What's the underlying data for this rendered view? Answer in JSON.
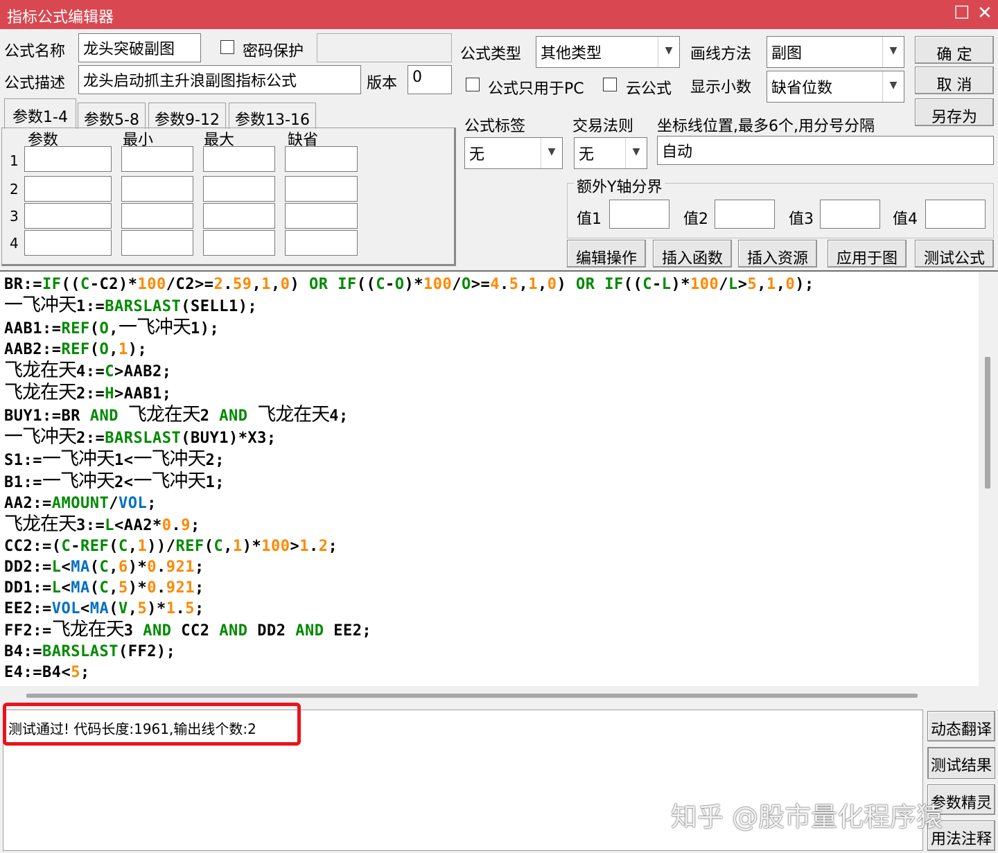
{
  "window": {
    "title": "指标公式编辑器",
    "maximize_glyph": "☐",
    "close_glyph": "✕"
  },
  "form": {
    "name_label": "公式名称",
    "name_value": "龙头突破副图",
    "password_label": "密码保护",
    "desc_label": "公式描述",
    "desc_value": "龙头启动抓主升浪副图指标公式",
    "version_label": "版本",
    "version_value": "0",
    "type_label": "公式类型",
    "type_value": "其他类型",
    "draw_label": "画线方法",
    "draw_value": "副图",
    "pc_only_label": "公式只用于PC",
    "cloud_label": "云公式",
    "decimals_label": "显示小数",
    "decimals_value": "缺省位数",
    "tag_label": "公式标签",
    "tag_value": "无",
    "trade_label": "交易法则",
    "trade_value": "无",
    "axis_label": "坐标线位置,最多6个,用分号分隔",
    "axis_value": "自动",
    "extra_y_label": "额外Y轴分界",
    "y_values": [
      "值1",
      "值2",
      "值3",
      "值4"
    ]
  },
  "buttons": {
    "ok": "确  定",
    "cancel": "取  消",
    "save_as": "另存为",
    "edit_ops": "编辑操作",
    "insert_func": "插入函数",
    "insert_res": "插入资源",
    "apply_chart": "应用于图",
    "test_formula": "测试公式",
    "dyn_translate": "动态翻译",
    "test_result": "测试结果",
    "param_wizard": "参数精灵",
    "usage_notes": "用法注释"
  },
  "params": {
    "tabs": [
      "参数1-4",
      "参数5-8",
      "参数9-12",
      "参数13-16"
    ],
    "headers": [
      "参数",
      "最小",
      "最大",
      "缺省"
    ],
    "rows": [
      "1",
      "2",
      "3",
      "4"
    ]
  },
  "output": {
    "text": "测试通过! 代码长度:1961,输出线个数:2"
  },
  "watermark": "知乎 @股市量化程序猿",
  "colors": {
    "titlebar": "#d94851",
    "keyword_green": "#008a00",
    "number_orange": "#ff8800",
    "function_blue": "#0070c0",
    "highlight_red": "#e8141c"
  }
}
